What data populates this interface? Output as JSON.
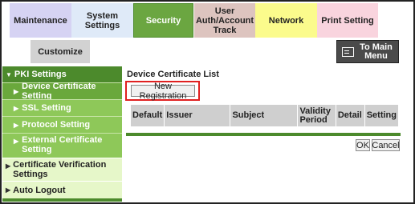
{
  "tabs": {
    "maintenance": "Maintenance",
    "system_settings": "System Settings",
    "security": "Security",
    "user_auth": "User Auth/Account Track",
    "network": "Network",
    "print_setting": "Print Setting",
    "customize": "Customize"
  },
  "main_menu_button": "To Main Menu",
  "sidebar": {
    "header": "PKI Settings",
    "items": [
      {
        "label": "Device Certificate Setting",
        "active": true
      },
      {
        "label": "SSL Setting"
      },
      {
        "label": "Protocol Setting"
      },
      {
        "label": "External Certificate Setting"
      }
    ],
    "lower_items": [
      {
        "label": "Certificate Verification Settings"
      },
      {
        "label": "Auto Logout"
      }
    ]
  },
  "content": {
    "title": "Device Certificate List",
    "new_registration_button": "New Registration",
    "table_headers": [
      "Default",
      "Issuer",
      "Subject",
      "Validity Period",
      "Detail",
      "Setting"
    ],
    "ok_button": "OK",
    "cancel_button": "Cancel"
  },
  "colors": {
    "security_tab": "#6ba641",
    "sidebar_header": "#4c8a2c",
    "sidebar_item": "#8ec859",
    "highlight_frame": "#e02020"
  }
}
